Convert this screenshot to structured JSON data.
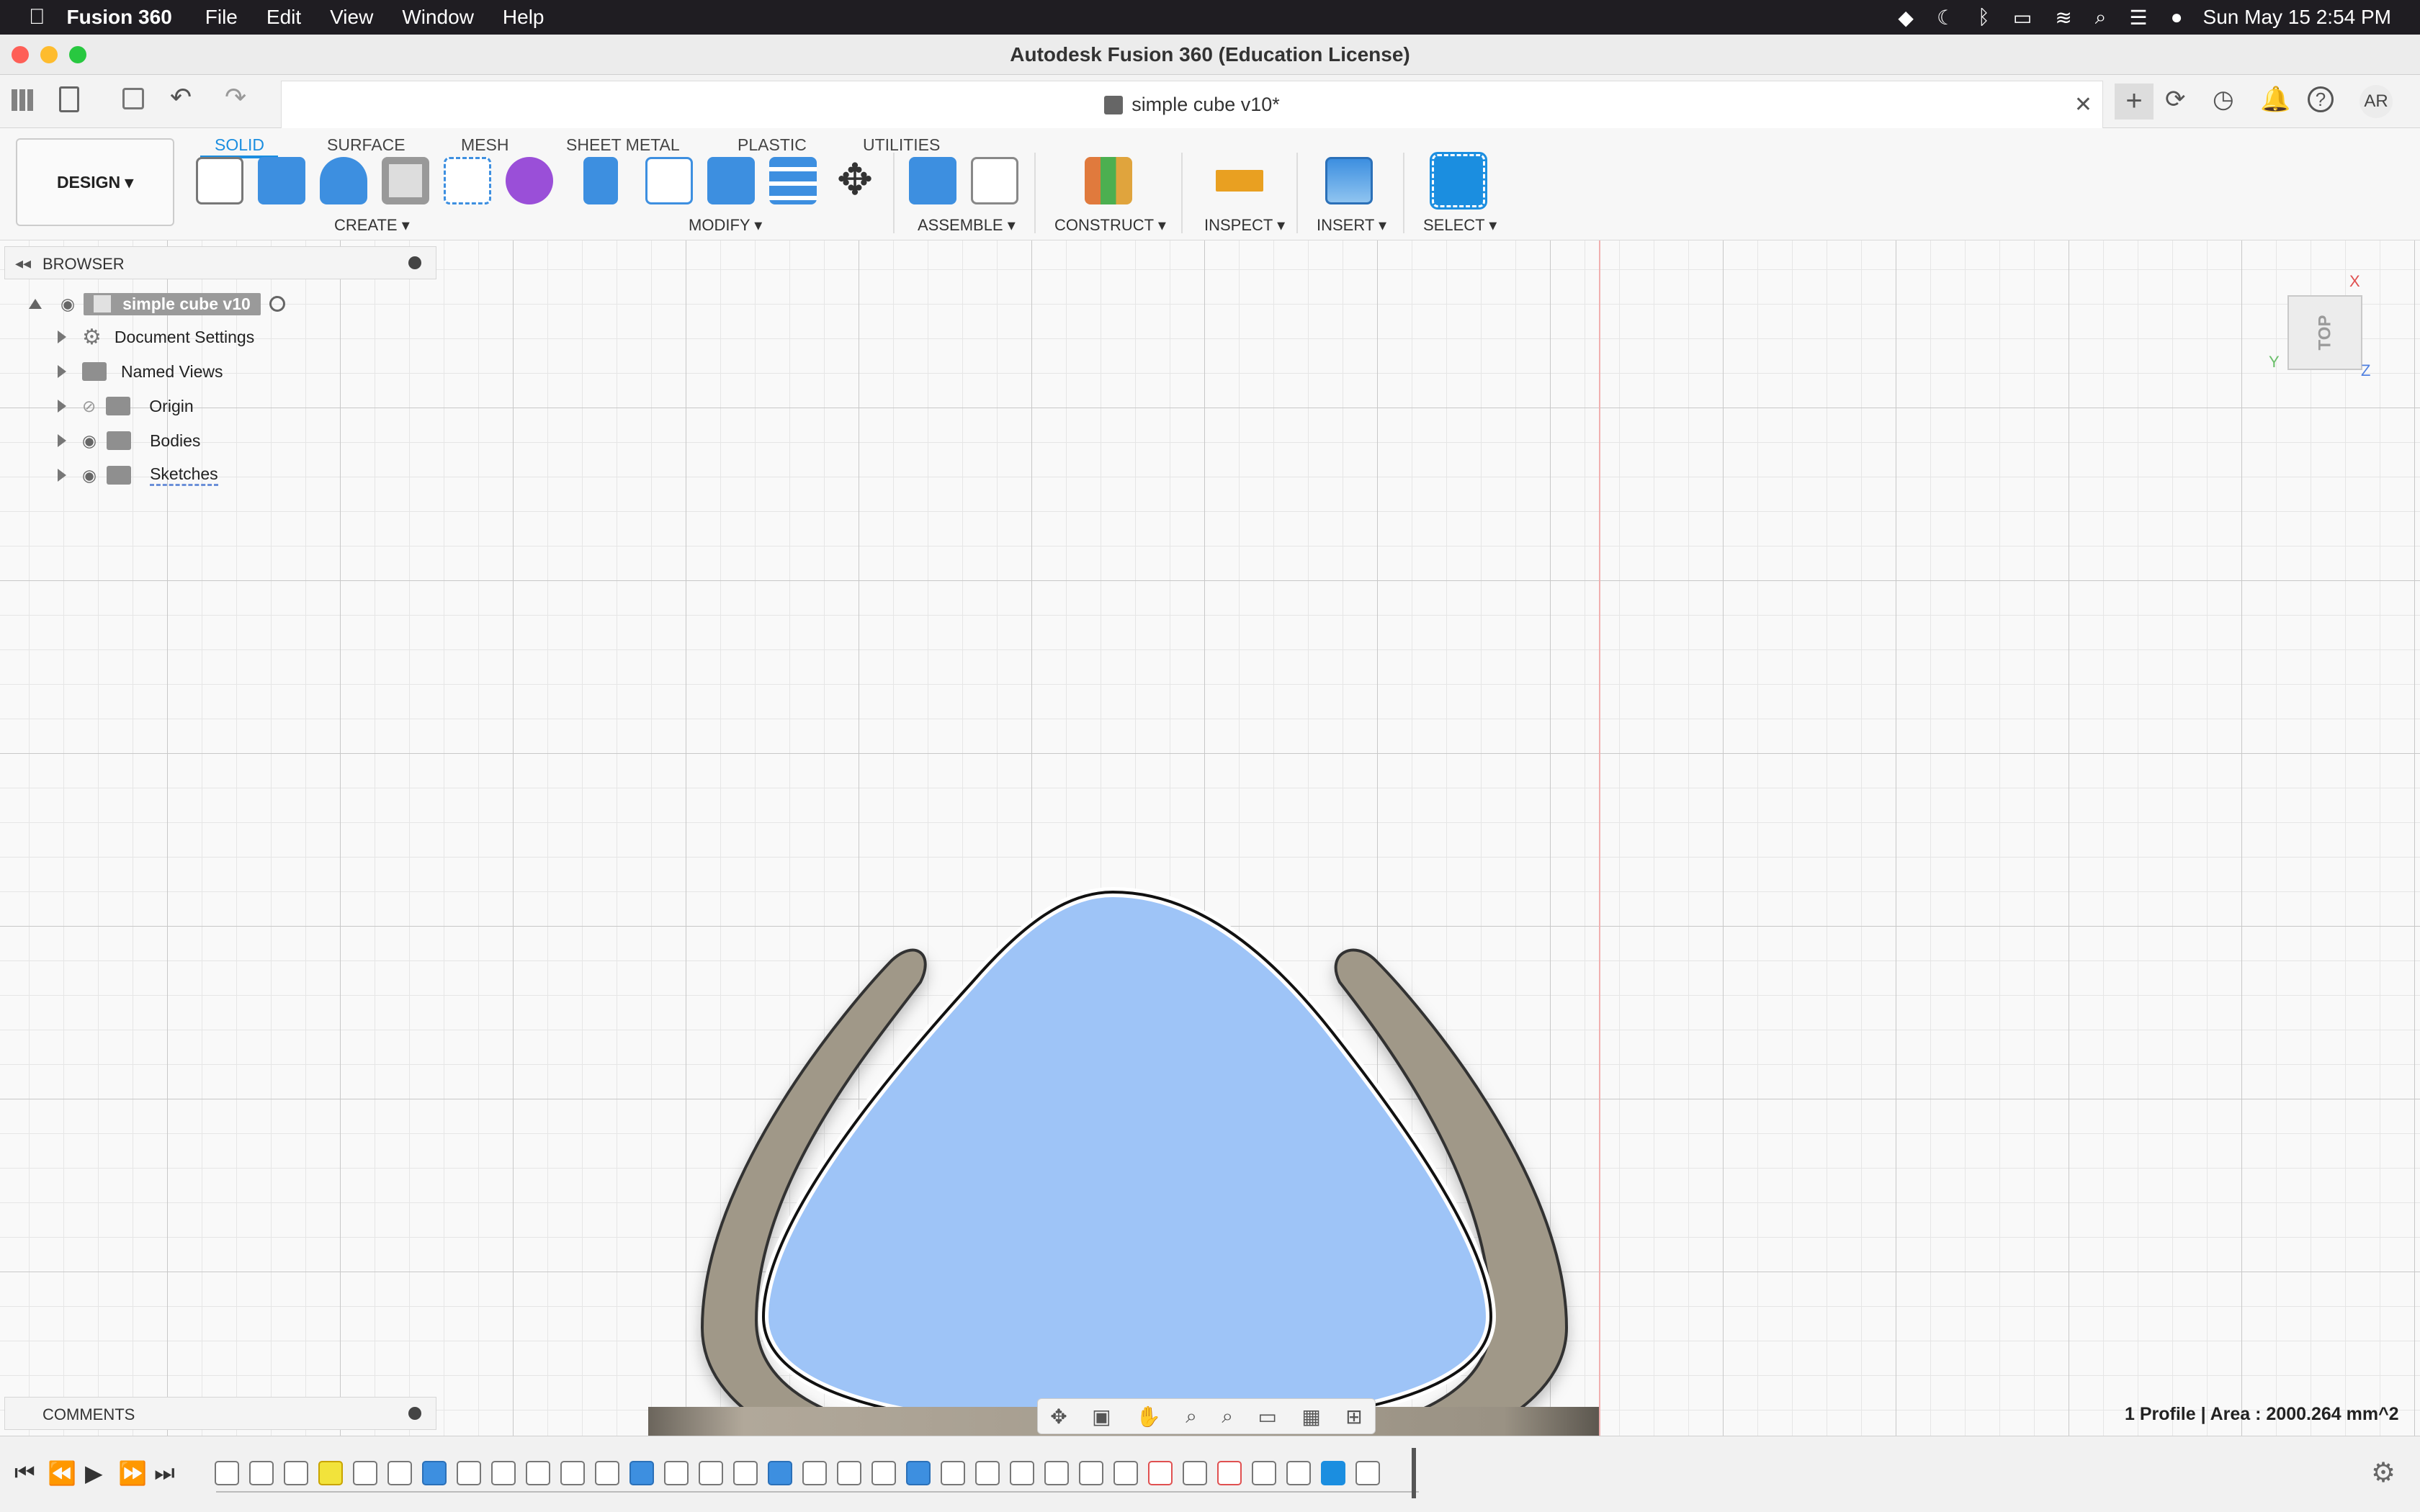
{
  "menubar": {
    "apple_icon": "apple-icon",
    "app_name": "Fusion 360",
    "items": [
      "File",
      "Edit",
      "View",
      "Window",
      "Help"
    ],
    "clock": "Sun May 15  2:54 PM"
  },
  "window": {
    "title": "Autodesk Fusion 360 (Education License)"
  },
  "tabbar": {
    "doc_tab_title": "simple cube v10*",
    "user_initials": "AR"
  },
  "toolbar": {
    "workspace_label": "DESIGN ▾",
    "tabs": [
      "SOLID",
      "SURFACE",
      "MESH",
      "SHEET METAL",
      "PLASTIC",
      "UTILITIES"
    ],
    "active_tab": "SOLID",
    "groups": [
      "CREATE ▾",
      "MODIFY ▾",
      "ASSEMBLE ▾",
      "CONSTRUCT ▾",
      "INSPECT ▾",
      "INSERT ▾",
      "SELECT ▾"
    ]
  },
  "browser": {
    "header": "BROWSER",
    "root": "simple cube v10",
    "items": [
      "Document Settings",
      "Named Views",
      "Origin",
      "Bodies",
      "Sketches"
    ]
  },
  "comments": {
    "header": "COMMENTS"
  },
  "viewcube": {
    "face": "TOP",
    "axis_x": "X",
    "axis_y": "Y",
    "axis_z": "Z"
  },
  "status": {
    "profile_info": "1 Profile | Area : 2000.264 mm^2"
  },
  "colors": {
    "accent": "#1b8ee0",
    "profile_fill": "#9ec4f7",
    "body_fill": "#a09888",
    "menubar_bg": "#1f1d22"
  }
}
